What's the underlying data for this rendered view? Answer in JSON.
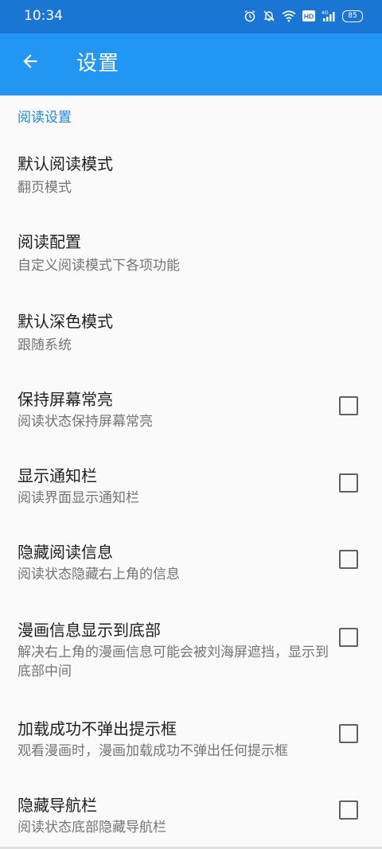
{
  "status_bar": {
    "time": "10:34",
    "icons": [
      "alarm-icon",
      "mute-icon",
      "wifi-icon",
      "hd-icon",
      "signal-4g-icon"
    ],
    "hd_label": "HD",
    "network_label": "4G",
    "battery_level": "85"
  },
  "app_bar": {
    "title": "设置",
    "back_icon": "arrow-back-icon"
  },
  "colors": {
    "status_bar": "#1976d2",
    "app_bar": "#2196f3",
    "section_header": "#1e88e5",
    "background": "#fafafa"
  },
  "section": {
    "header": "阅读设置"
  },
  "preferences": [
    {
      "title": "默认阅读模式",
      "summary": "翻页模式",
      "has_checkbox": false
    },
    {
      "title": "阅读配置",
      "summary": "自定义阅读模式下各项功能",
      "has_checkbox": false
    },
    {
      "title": "默认深色模式",
      "summary": "跟随系统",
      "has_checkbox": false
    },
    {
      "title": "保持屏幕常亮",
      "summary": "阅读状态保持屏幕常亮",
      "has_checkbox": true,
      "checked": false
    },
    {
      "title": "显示通知栏",
      "summary": "阅读界面显示通知栏",
      "has_checkbox": true,
      "checked": false
    },
    {
      "title": "隐藏阅读信息",
      "summary": "阅读状态隐藏右上角的信息",
      "has_checkbox": true,
      "checked": false
    },
    {
      "title": "漫画信息显示到底部",
      "summary": "解决右上角的漫画信息可能会被刘海屏遮挡，显示到底部中间",
      "has_checkbox": true,
      "checked": false
    },
    {
      "title": "加载成功不弹出提示框",
      "summary": "观看漫画时，漫画加载成功不弹出任何提示框",
      "has_checkbox": true,
      "checked": false
    },
    {
      "title": "隐藏导航栏",
      "summary": "阅读状态底部隐藏导航栏",
      "has_checkbox": true,
      "checked": false
    }
  ]
}
